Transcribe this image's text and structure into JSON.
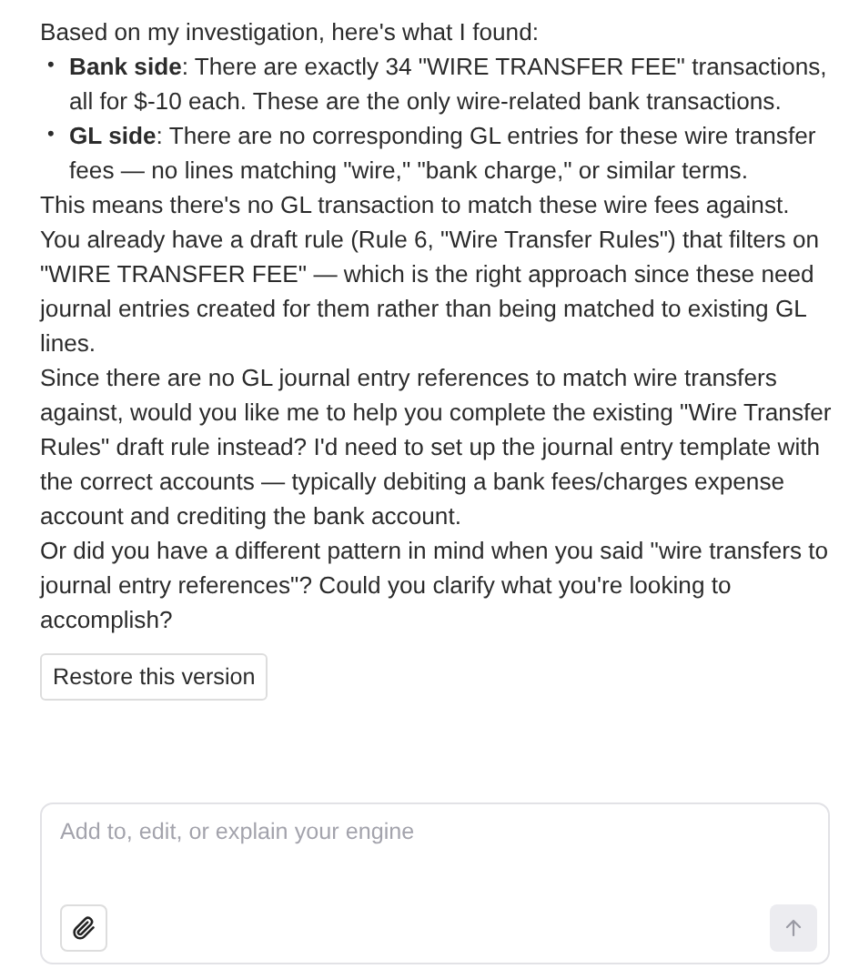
{
  "message": {
    "blocks": [
      {
        "kind": "paragraph",
        "text": "Based on my investigation, here's what I found:"
      },
      {
        "kind": "bullet",
        "marker": "•",
        "text": "**Bank side**: There are exactly 34 \"WIRE TRANSFER FEE\" transactions, all for $-10 each. These are the only wire-related bank transactions."
      },
      {
        "kind": "bullet",
        "marker": "•",
        "text": "**GL side**: There are no corresponding GL entries for these wire transfer fees — no lines matching \"wire,\" \"bank charge,\" or similar terms."
      },
      {
        "kind": "paragraph",
        "text": "This means there's no GL transaction to match these wire fees against."
      },
      {
        "kind": "paragraph",
        "text": "You already have a draft rule (Rule 6, \"Wire Transfer Rules\") that filters on \"WIRE TRANSFER FEE\" — which is the right approach since these need journal entries created for them rather than being matched to existing GL lines."
      },
      {
        "kind": "paragraph",
        "text": "Since there are no GL journal entry references to match wire transfers against, would you like me to help you complete the existing \"Wire Transfer Rules\" draft rule instead? I'd need to set up the journal entry template with the correct accounts — typically debiting a bank fees/charges expense account and crediting the bank account."
      },
      {
        "kind": "paragraph",
        "text": "Or did you have a different pattern in mind when you said \"wire transfers to journal entry references\"? Could you clarify what you're looking to accomplish?"
      }
    ]
  },
  "restore_button": "Restore this version",
  "composer": {
    "placeholder": "Add to, edit, or explain your engine",
    "send_disabled": true
  }
}
